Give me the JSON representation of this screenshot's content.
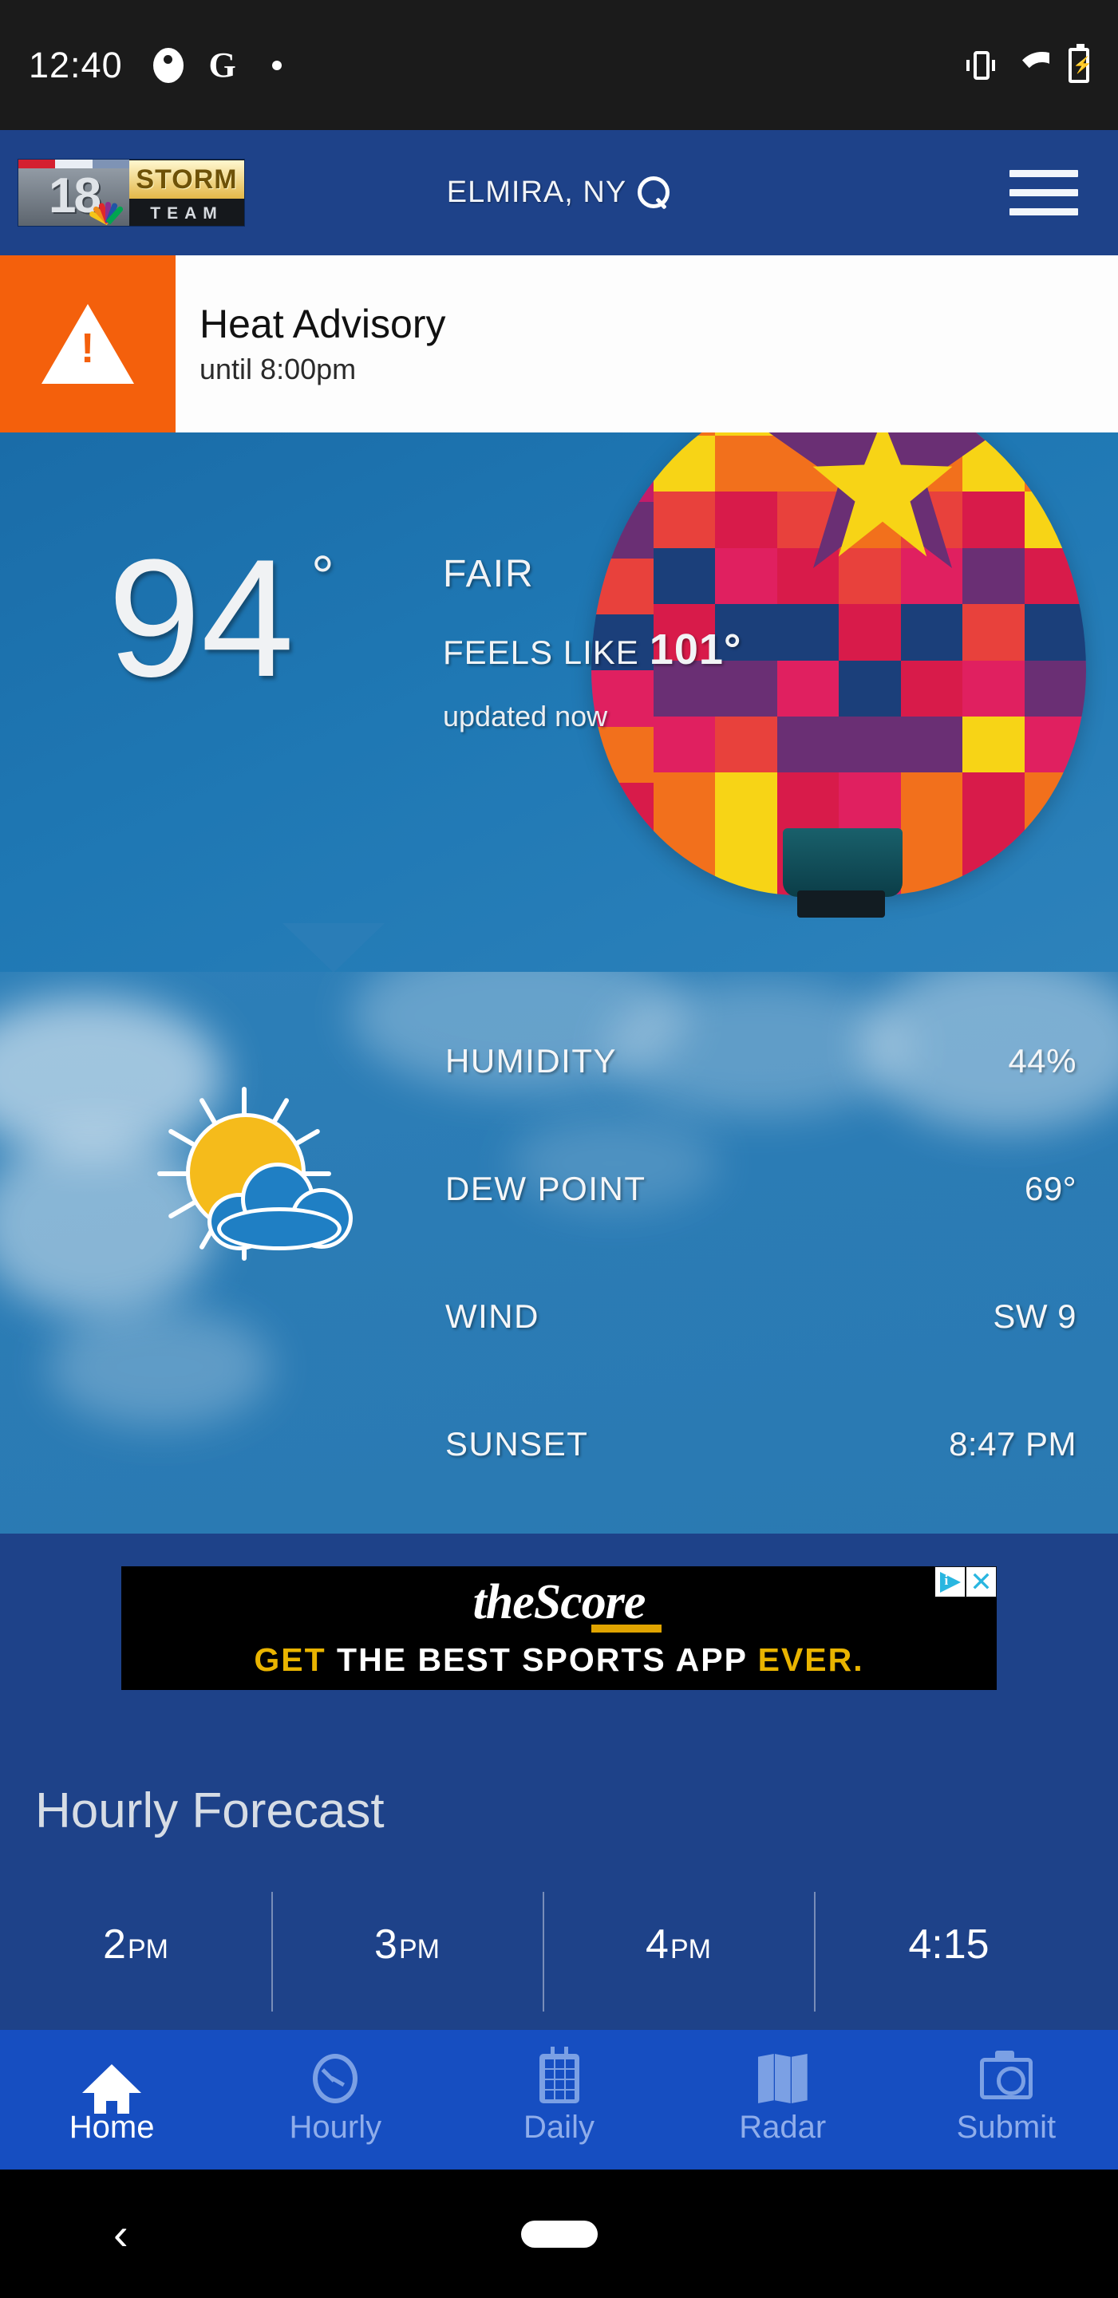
{
  "status_bar": {
    "time": "12:40",
    "left_icons": [
      "app-notification-icon",
      "google-icon",
      "dot-icon"
    ],
    "right_icons": [
      "vibrate-icon",
      "wifi-icon",
      "battery-charging-icon"
    ]
  },
  "app_header": {
    "logo_channel": "18",
    "logo_storm": "STORM",
    "logo_team": "TEAM",
    "location": "ELMIRA, NY",
    "search_icon": "search-icon",
    "menu_icon": "hamburger-menu-icon"
  },
  "alert": {
    "icon": "warning-triangle-icon",
    "title": "Heat Advisory",
    "subtitle": "until 8:00pm",
    "accent_color": "#f4600c"
  },
  "current": {
    "temperature": "94",
    "degree": "°",
    "condition": "FAIR",
    "feels_like_label": "FEELS LIKE",
    "feels_like_value": "101°",
    "updated": "updated now",
    "background_image": "hot-air-balloon-photo"
  },
  "details": {
    "icon": "sun-behind-cloud-icon",
    "rows": [
      {
        "label": "HUMIDITY",
        "value": "44%"
      },
      {
        "label": "DEW POINT",
        "value": "69°"
      },
      {
        "label": "WIND",
        "value": "SW 9"
      },
      {
        "label": "SUNSET",
        "value": "8:47 PM"
      }
    ]
  },
  "ad": {
    "brand": "theScore",
    "tagline_parts": [
      {
        "text": "GET",
        "color": "#e9b400"
      },
      {
        "text": "THE BEST SPORTS APP",
        "color": "#ffffff"
      },
      {
        "text": "EVER.",
        "color": "#e9b400"
      }
    ],
    "adchoices_icon": "adchoices-icon",
    "close_icon": "close-icon"
  },
  "hourly": {
    "title": "Hourly Forecast",
    "cells": [
      {
        "hour": "2",
        "suffix": "PM"
      },
      {
        "hour": "3",
        "suffix": "PM"
      },
      {
        "hour": "4",
        "suffix": "PM"
      },
      {
        "hour": "4:15",
        "suffix": ""
      }
    ]
  },
  "bottom_nav": {
    "items": [
      {
        "label": "Home",
        "icon": "home-icon",
        "active": true
      },
      {
        "label": "Hourly",
        "icon": "clock-icon",
        "active": false
      },
      {
        "label": "Daily",
        "icon": "calendar-icon",
        "active": false
      },
      {
        "label": "Radar",
        "icon": "map-icon",
        "active": false
      },
      {
        "label": "Submit",
        "icon": "camera-icon",
        "active": false
      }
    ]
  },
  "system_nav": {
    "back_icon": "back-chevron-icon",
    "home_pill": "home-pill-indicator"
  },
  "colors": {
    "brand_blue": "#1e4289",
    "nav_blue": "#164ec1",
    "alert_orange": "#f4600c",
    "sky_blue": "#2a79b2"
  }
}
